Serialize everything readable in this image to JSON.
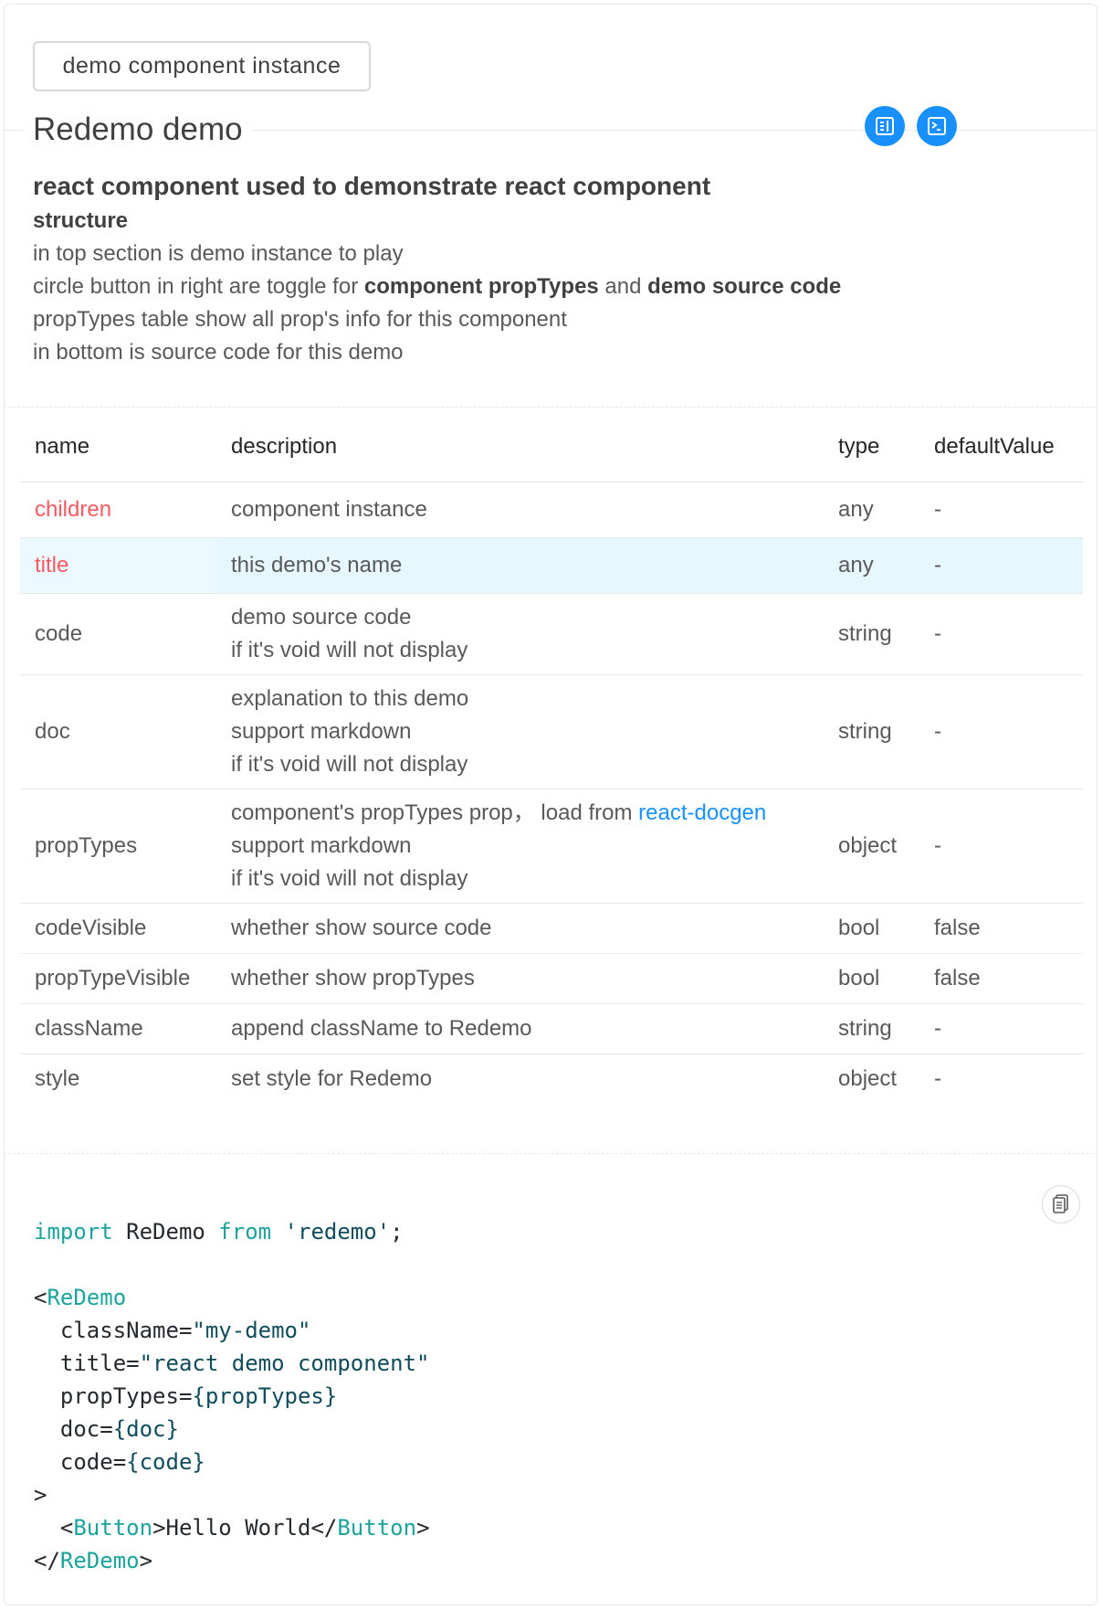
{
  "demo": {
    "button_label": "demo component instance"
  },
  "header": {
    "title": "Redemo demo"
  },
  "doc": {
    "heading": "react component used to demonstrate react component",
    "subheading": "structure",
    "line1": "in top section is demo instance to play",
    "line2_pre": "circle button in right are toggle for ",
    "line2_b1": "component propTypes",
    "line2_mid": " and ",
    "line2_b2": "demo source code",
    "line3": "propTypes table show all prop's info for this component",
    "line4": "in bottom is source code for this demo"
  },
  "table": {
    "headers": [
      "name",
      "description",
      "type",
      "defaultValue"
    ],
    "rows": [
      {
        "name": "children",
        "desc": [
          "component instance"
        ],
        "type": "any",
        "default": "-"
      },
      {
        "name": "title",
        "desc": [
          "this demo's name"
        ],
        "type": "any",
        "default": "-"
      },
      {
        "name": "code",
        "desc": [
          "demo source code",
          "if it's void will not display"
        ],
        "type": "string",
        "default": "-"
      },
      {
        "name": "doc",
        "desc": [
          "explanation to this demo",
          "support markdown",
          "if it's void will not display"
        ],
        "type": "string",
        "default": "-"
      },
      {
        "name": "propTypes",
        "desc": [
          "component's propTypes prop， load from ",
          "support markdown",
          "if it's void will not display"
        ],
        "desc_link": "react-docgen",
        "type": "object",
        "default": "-"
      },
      {
        "name": "codeVisible",
        "desc": [
          "whether show source code"
        ],
        "type": "bool",
        "default": "false"
      },
      {
        "name": "propTypeVisible",
        "desc": [
          "whether show propTypes"
        ],
        "type": "bool",
        "default": "false"
      },
      {
        "name": "className",
        "desc": [
          "append className to Redemo"
        ],
        "type": "string",
        "default": "-"
      },
      {
        "name": "style",
        "desc": [
          "set style for Redemo"
        ],
        "type": "object",
        "default": "-"
      }
    ]
  },
  "code": {
    "import_kw": "import",
    "import_name": " ReDemo ",
    "from_kw": "from",
    "module": " 'redemo'",
    "semicolon": ";",
    "open_lt": "<",
    "component": "ReDemo",
    "attr1_name": "  className=",
    "attr1_val": "\"my-demo\"",
    "attr2_name": "  title=",
    "attr2_val": "\"react demo component\"",
    "attr3_name": "  propTypes=",
    "attr3_val": "{propTypes}",
    "attr4_name": "  doc=",
    "attr4_val": "{doc}",
    "attr5_name": "  code=",
    "attr5_val": "{code}",
    "gt": ">",
    "child_open_lt": "  <",
    "child_tag": "Button",
    "child_text": ">Hello World</",
    "child_close_tag": "Button",
    "child_close_gt": ">",
    "close_lt": "</",
    "close_tag": "ReDemo",
    "close_gt": ">"
  },
  "colors": {
    "accent": "#1890ff",
    "highlight_row": "#e6f7ff",
    "name_red": "#f5222d",
    "code_keyword": "#1ba39c"
  },
  "icons": {
    "doc_toggle": "doc-table-icon",
    "code_toggle": "terminal-icon",
    "copy": "copy-icon"
  }
}
